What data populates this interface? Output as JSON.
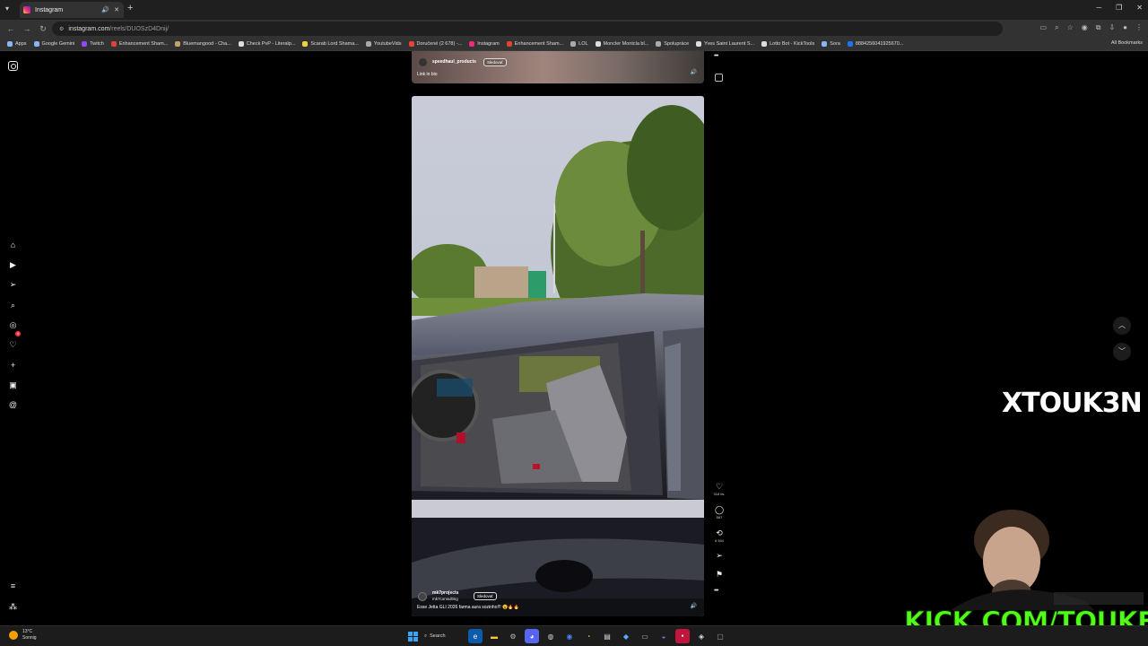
{
  "browser": {
    "tab_title": "Instagram",
    "url_domain": "instagram.com",
    "url_path": "/reels/DUOSzD4Dnij/",
    "bookmarks": [
      {
        "label": "Apps",
        "color": "#8ab4f8"
      },
      {
        "label": "Google Gemini",
        "color": "#8ab4f8"
      },
      {
        "label": "Twitch",
        "color": "#9146ff"
      },
      {
        "label": "Enhancement Sham...",
        "color": "#e34234"
      },
      {
        "label": "Bluemangood - Cha...",
        "color": "#c8a06a"
      },
      {
        "label": "Check PvP - Literalp...",
        "color": "#dddddd"
      },
      {
        "label": "Scarab Lord Shama...",
        "color": "#f5d142"
      },
      {
        "label": "YoutubeVids",
        "color": "#aaaaaa"
      },
      {
        "label": "Doručené (2 678) -...",
        "color": "#ea4335"
      },
      {
        "label": "Instagram",
        "color": "#ee2a7b"
      },
      {
        "label": "Enhancement Sham...",
        "color": "#e34234"
      },
      {
        "label": "LOL",
        "color": "#aaaaaa"
      },
      {
        "label": "Moncler Montcla bl...",
        "color": "#dddddd"
      },
      {
        "label": "Spolupráce",
        "color": "#aaaaaa"
      },
      {
        "label": "Yves Saint Laurent S...",
        "color": "#dddddd"
      },
      {
        "label": "Lotto Bot - KickTools",
        "color": "#dddddd"
      },
      {
        "label": "Sora",
        "color": "#8ab4f8"
      },
      {
        "label": "8884256041925670...",
        "color": "#1877f2"
      }
    ],
    "all_bookmarks": "All Bookmarks"
  },
  "instagram": {
    "sidebar": [
      {
        "name": "home-icon",
        "glyph": "⌂"
      },
      {
        "name": "reels-icon",
        "glyph": "▶"
      },
      {
        "name": "messages-icon",
        "glyph": "➢"
      },
      {
        "name": "search-icon",
        "glyph": "⌕"
      },
      {
        "name": "explore-icon",
        "glyph": "◎"
      },
      {
        "name": "notifications-icon",
        "glyph": "♡"
      },
      {
        "name": "create-icon",
        "glyph": "+"
      },
      {
        "name": "dashboard-icon",
        "glyph": "▣"
      },
      {
        "name": "threads-icon",
        "glyph": "@"
      }
    ],
    "messages_badge": "4",
    "previous_reel": {
      "username": "speedhaul_products",
      "follow": "Sledovať",
      "caption": "Link in bio"
    },
    "reel": {
      "username": "mk7projects",
      "collab": "mk7consulting",
      "follow": "Sledovať",
      "caption": "Esse Jetta GLI 2026 farma aura sozinho!!! 😮🔥🔥",
      "likes": "318 tis.",
      "comments": "667",
      "reposts": "6 534"
    }
  },
  "overlay": {
    "x_handle": "XTOUK3N",
    "kick": "KICK.COM/TOUKEN"
  },
  "taskbar": {
    "temperature": "13°C",
    "weather": "Sonnig",
    "search": "Search"
  }
}
